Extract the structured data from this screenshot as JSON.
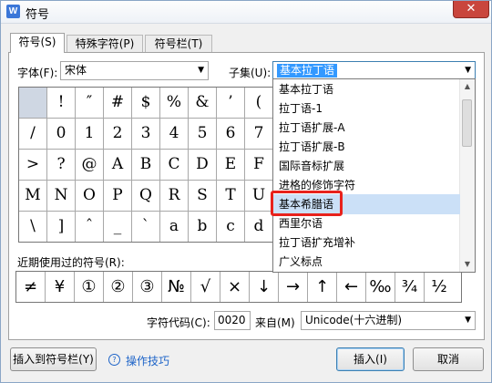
{
  "window": {
    "title": "符号",
    "app_icon": "W",
    "close": "✕"
  },
  "tabs": [
    {
      "label": "符号(S)",
      "active": true
    },
    {
      "label": "特殊字符(P)",
      "active": false
    },
    {
      "label": "符号栏(T)",
      "active": false
    }
  ],
  "font": {
    "label": "字体(F):",
    "value": "宋体"
  },
  "subset": {
    "label": "子集(U):",
    "value": "基本拉丁语"
  },
  "symbols": [
    " ",
    "!",
    "″",
    "#",
    "$",
    "%",
    "&",
    "’",
    "(",
    "/",
    "0",
    "1",
    "2",
    "3",
    "4",
    "5",
    "6",
    "7",
    ">",
    "?",
    "@",
    "A",
    "B",
    "C",
    "D",
    "E",
    "F",
    "M",
    "N",
    "O",
    "P",
    "Q",
    "R",
    "S",
    "T",
    "U",
    "\\",
    "]",
    "ˆ",
    "_",
    "`",
    "a",
    "b",
    "c",
    "d"
  ],
  "subset_options": [
    "基本拉丁语",
    "拉丁语-1",
    "拉丁语扩展-A",
    "拉丁语扩展-B",
    "国际音标扩展",
    "进格的修饰字符",
    "基本希腊语",
    "西里尔语",
    "拉丁语扩充增补",
    "广义标点"
  ],
  "highlighted_option": "基本希腊语",
  "recent": {
    "label": "近期使用过的符号(R):",
    "symbols": [
      "≠",
      "¥",
      "①",
      "②",
      "③",
      "№",
      "√",
      "×",
      "↓",
      "→",
      "↑",
      "←",
      "‰",
      "¾",
      "½"
    ]
  },
  "char_code": {
    "label": "字符代码(C):",
    "value": "0020"
  },
  "from": {
    "label": "来自(M)",
    "value": "Unicode(十六进制)"
  },
  "buttons": {
    "insert_to_bar": "插入到符号栏(Y)",
    "tips": "操作技巧",
    "insert": "插入(I)",
    "cancel": "取消"
  }
}
